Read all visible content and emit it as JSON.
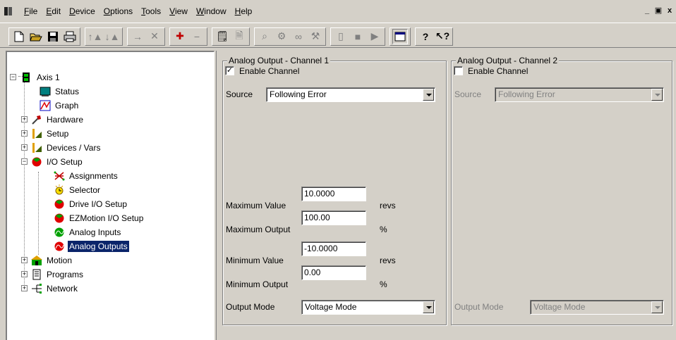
{
  "menu": [
    "File",
    "Edit",
    "Device",
    "Options",
    "Tools",
    "View",
    "Window",
    "Help"
  ],
  "menu_underline": [
    "F",
    "E",
    "D",
    "O",
    "T",
    "V",
    "W",
    "H"
  ],
  "window_controls": {
    "minimize": "_",
    "restore": "▫",
    "close": "x"
  },
  "toolbar": {
    "groups": [
      [
        "new-icon",
        "open-icon",
        "save-icon",
        "print-icon"
      ],
      [
        "upload-icon",
        "download-icon"
      ],
      [
        "import-icon",
        "cut-icon"
      ],
      [
        "add-axis-icon",
        "remove-axis-icon"
      ],
      [
        "properties-icon",
        "program-icon"
      ],
      [
        "zoom-icon",
        "tools-icon",
        "watch-icon",
        "tune-icon"
      ],
      [
        "phone-icon",
        "stop-icon",
        "run-icon"
      ],
      [
        "window-icon"
      ],
      [
        "help-icon",
        "context-help-icon"
      ]
    ]
  },
  "tree": {
    "root": "Axis 1",
    "items": [
      {
        "label": "Status",
        "icon": "status-icon"
      },
      {
        "label": "Graph",
        "icon": "graph-icon"
      },
      {
        "label": "Hardware",
        "icon": "hardware-icon"
      },
      {
        "label": "Setup",
        "icon": "setup-icon"
      },
      {
        "label": "Devices / Vars",
        "icon": "devices-icon"
      },
      {
        "label": "I/O Setup",
        "icon": "io-setup-icon"
      },
      {
        "label": "Assignments",
        "icon": "assignments-icon"
      },
      {
        "label": "Selector",
        "icon": "selector-icon"
      },
      {
        "label": "Drive I/O Setup",
        "icon": "drive-io-icon"
      },
      {
        "label": "EZMotion I/O Setup",
        "icon": "ezmotion-io-icon"
      },
      {
        "label": "Analog Inputs",
        "icon": "analog-inputs-icon"
      },
      {
        "label": "Analog Outputs",
        "icon": "analog-outputs-icon"
      },
      {
        "label": "Motion",
        "icon": "motion-icon"
      },
      {
        "label": "Programs",
        "icon": "programs-icon"
      },
      {
        "label": "Network",
        "icon": "network-icon"
      }
    ],
    "selected": "Analog Outputs"
  },
  "channel1": {
    "title": "Analog Output - Channel 1",
    "enable_label": "Enable Channel",
    "enabled": true,
    "source_label": "Source",
    "source_value": "Following Error",
    "max_value_label": "Maximum Value",
    "max_value": "10.0000",
    "max_value_unit": "revs",
    "max_output_label": "Maximum Output",
    "max_output": "100.00",
    "max_output_unit": "%",
    "min_value_label": "Minimum Value",
    "min_value": "-10.0000",
    "min_value_unit": "revs",
    "min_output_label": "Minimum Output",
    "min_output": "0.00",
    "min_output_unit": "%",
    "output_mode_label": "Output Mode",
    "output_mode_value": "Voltage Mode"
  },
  "channel2": {
    "title": "Analog Output - Channel 2",
    "enable_label": "Enable Channel",
    "enabled": false,
    "source_label": "Source",
    "source_value": "Following Error",
    "output_mode_label": "Output Mode",
    "output_mode_value": "Voltage Mode"
  }
}
